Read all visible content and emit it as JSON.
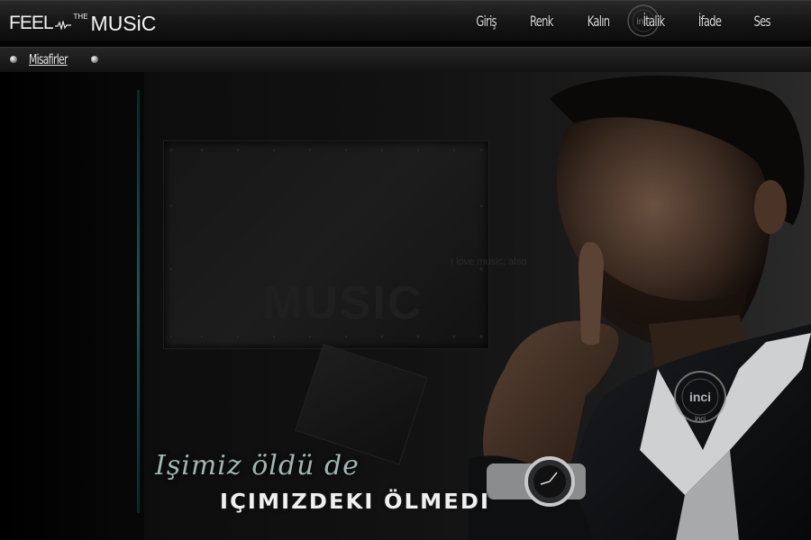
{
  "header": {
    "logo": {
      "feel": "FEEL",
      "the": "THE",
      "music": "MUSiC"
    },
    "menu": [
      {
        "label": "Giriş"
      },
      {
        "label": "Renk"
      },
      {
        "label": "Kalın"
      },
      {
        "label": "İtalik"
      },
      {
        "label": "İfade"
      },
      {
        "label": "Ses"
      }
    ],
    "watermark": "inci"
  },
  "subbar": {
    "guest_label": "Misafirler"
  },
  "banner": {
    "plate_text": "MUSIC",
    "plate_small": "I love music, also",
    "quote_line1": "Işimiz öldü de",
    "quote_line2": "IÇIMIZDEKI ÖLMEDI",
    "watermark": "inci",
    "watermark_sub": "inci"
  },
  "colors": {
    "accent_teal": "#1f6d6a",
    "quote_color": "#9fb6b2"
  }
}
